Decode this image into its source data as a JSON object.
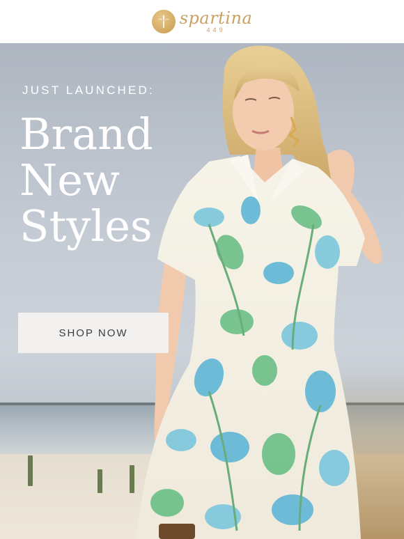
{
  "brand": {
    "name": "spartina",
    "number": "449"
  },
  "hero": {
    "tagline": "JUST LAUNCHED:",
    "headline_lines": [
      "Brand",
      "New",
      "Styles"
    ],
    "cta_label": "SHOP NOW",
    "photo_alt": "Woman in a floral print shirt dress on a beach"
  },
  "colors": {
    "brand_gold": "#c9a062",
    "button_bg": "#f3f1ef",
    "button_text": "#3c3c3c",
    "dress_base": "#f4f1e6",
    "print_blue": "#5fb6d6",
    "print_green": "#6bbf86"
  }
}
